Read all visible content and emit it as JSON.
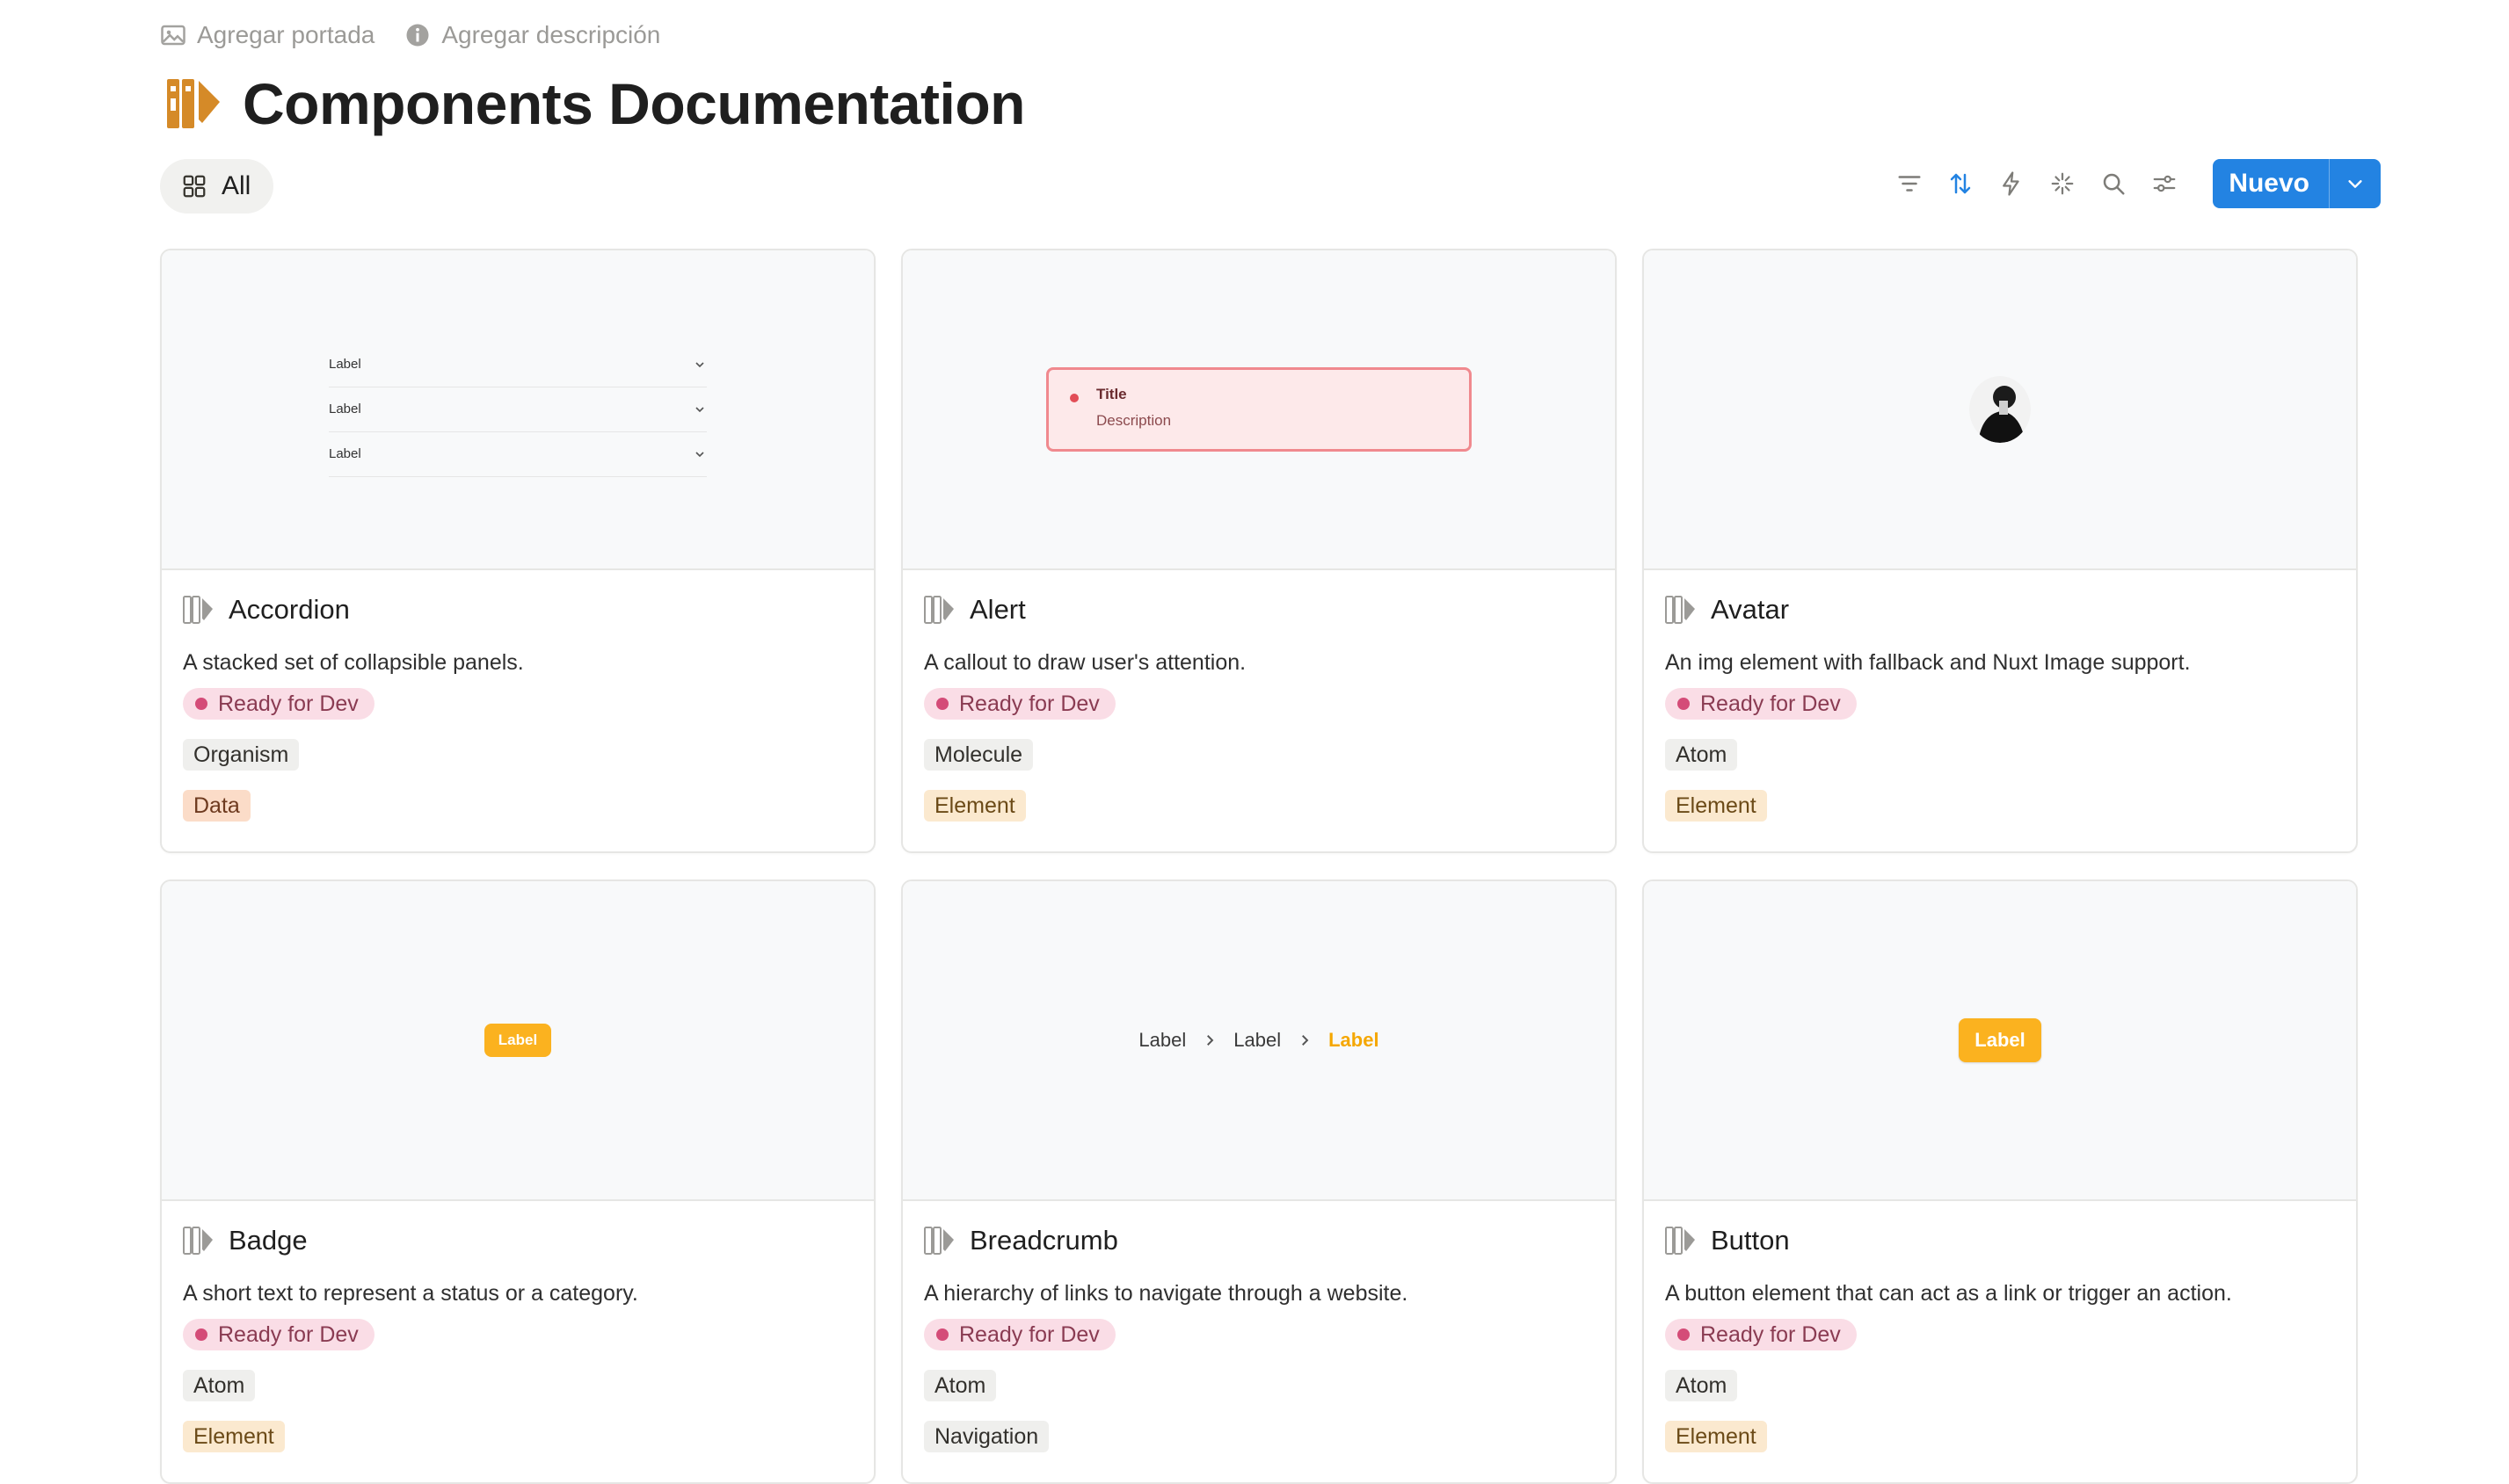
{
  "top_actions": {
    "cover": "Agregar portada",
    "description": "Agregar descripción"
  },
  "page": {
    "title": "Components Documentation"
  },
  "view": {
    "tab_label": "All"
  },
  "toolbar": {
    "new_label": "Nuevo"
  },
  "colors": {
    "accent": "#2383e2",
    "status_dot": "#d44c78",
    "badge_amber": "#fbb21f"
  },
  "cards": [
    {
      "title": "Accordion",
      "description": "A stacked set of collapsible panels.",
      "status": "Ready for Dev",
      "level": "Organism",
      "category": "Data",
      "preview": {
        "rows": [
          "Label",
          "Label",
          "Label"
        ]
      }
    },
    {
      "title": "Alert",
      "description": "A callout to draw user's attention.",
      "status": "Ready for Dev",
      "level": "Molecule",
      "category": "Element",
      "preview": {
        "title": "Title",
        "description": "Description"
      }
    },
    {
      "title": "Avatar",
      "description": "An img element with fallback and Nuxt Image support.",
      "status": "Ready for Dev",
      "level": "Atom",
      "category": "Element"
    },
    {
      "title": "Badge",
      "description": "A short text to represent a status or a category.",
      "status": "Ready for Dev",
      "level": "Atom",
      "category": "Element",
      "preview": {
        "label": "Label"
      }
    },
    {
      "title": "Breadcrumb",
      "description": "A hierarchy of links to navigate through a website.",
      "status": "Ready for Dev",
      "level": "Atom",
      "category": "Navigation",
      "preview": {
        "items": [
          "Label",
          "Label",
          "Label"
        ]
      }
    },
    {
      "title": "Button",
      "description": "A button element that can act as a link or trigger an action.",
      "status": "Ready for Dev",
      "level": "Atom",
      "category": "Element",
      "preview": {
        "label": "Label"
      }
    }
  ]
}
